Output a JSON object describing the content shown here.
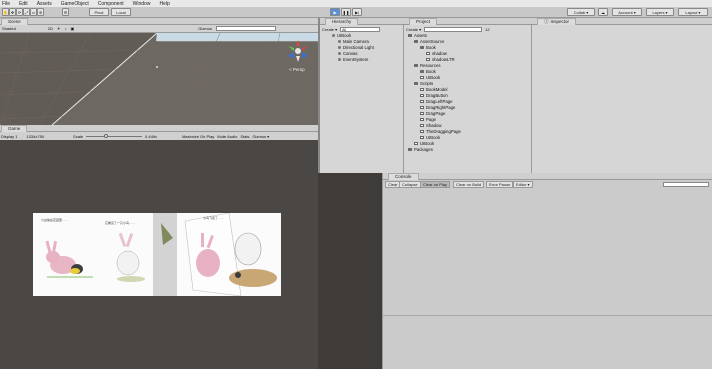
{
  "menu": [
    "File",
    "Edit",
    "Assets",
    "GameObject",
    "Component",
    "Window",
    "Help"
  ],
  "toolbar": {
    "pivot": "Pivot",
    "local": "Local",
    "collab": "Collab ▾",
    "account": "Account ▾",
    "layers": "Layers ▾",
    "layout": "Layout ▾"
  },
  "scene": {
    "tab": "Scene",
    "shading": "Shaded",
    "mode_2d": "2D",
    "gizmos": "Gizmos",
    "persp": "< Persp"
  },
  "game": {
    "tab": "Game",
    "display": "Display 1",
    "resolution": "1334x750",
    "scale_label": "Scale",
    "scale_value": "0.449x",
    "maximize": "Maximize On Play",
    "mute": "Mute Audio",
    "stats": "Stats",
    "gizmos": "Gizmos ▾"
  },
  "hierarchy": {
    "tab": "Hierarchy",
    "create": "Create ▾",
    "search_placeholder": "All",
    "items": [
      "UIBook",
      "Main Camera",
      "Directional Light",
      "Canvas",
      "EventSystem"
    ]
  },
  "project": {
    "tab": "Project",
    "create": "Create ▾",
    "count": "12",
    "items": [
      {
        "label": "Assets",
        "depth": 0,
        "type": "folder"
      },
      {
        "label": "AssetSource",
        "depth": 1,
        "type": "folder"
      },
      {
        "label": "Book",
        "depth": 2,
        "type": "folder"
      },
      {
        "label": "shadow",
        "depth": 3,
        "type": "file"
      },
      {
        "label": "shadowLTR",
        "depth": 3,
        "type": "file"
      },
      {
        "label": "Resources",
        "depth": 1,
        "type": "folder"
      },
      {
        "label": "Book",
        "depth": 2,
        "type": "folder"
      },
      {
        "label": "UIBook",
        "depth": 2,
        "type": "file"
      },
      {
        "label": "Scripts",
        "depth": 1,
        "type": "folder"
      },
      {
        "label": "BookModel",
        "depth": 2,
        "type": "script"
      },
      {
        "label": "DragButton",
        "depth": 2,
        "type": "script"
      },
      {
        "label": "DragLeftPage",
        "depth": 2,
        "type": "script"
      },
      {
        "label": "DragRightPage",
        "depth": 2,
        "type": "script"
      },
      {
        "label": "DragPage",
        "depth": 2,
        "type": "script"
      },
      {
        "label": "Page",
        "depth": 2,
        "type": "script"
      },
      {
        "label": "Shadow",
        "depth": 2,
        "type": "script"
      },
      {
        "label": "TheDraggingPage",
        "depth": 2,
        "type": "script"
      },
      {
        "label": "UIBook",
        "depth": 2,
        "type": "script"
      },
      {
        "label": "UIBook",
        "depth": 1,
        "type": "file"
      },
      {
        "label": "Packages",
        "depth": 0,
        "type": "folder"
      }
    ]
  },
  "inspector": {
    "tab": "Inspector"
  },
  "console": {
    "tab": "Console",
    "buttons": [
      "Clear",
      "Collapse",
      "Clear on Play",
      "Clear on Build",
      "Error Pause",
      "Editor ▾"
    ]
  },
  "book": {
    "caption_left": "小白兔在花园里……",
    "caption_mid": "它看见了一只小鸟……",
    "caption_right": "小鸟飞走了……"
  },
  "colors": {
    "accent": "#4a83d6",
    "game_bg": "#4a4745",
    "scene_sky": "#c7dbe8"
  }
}
